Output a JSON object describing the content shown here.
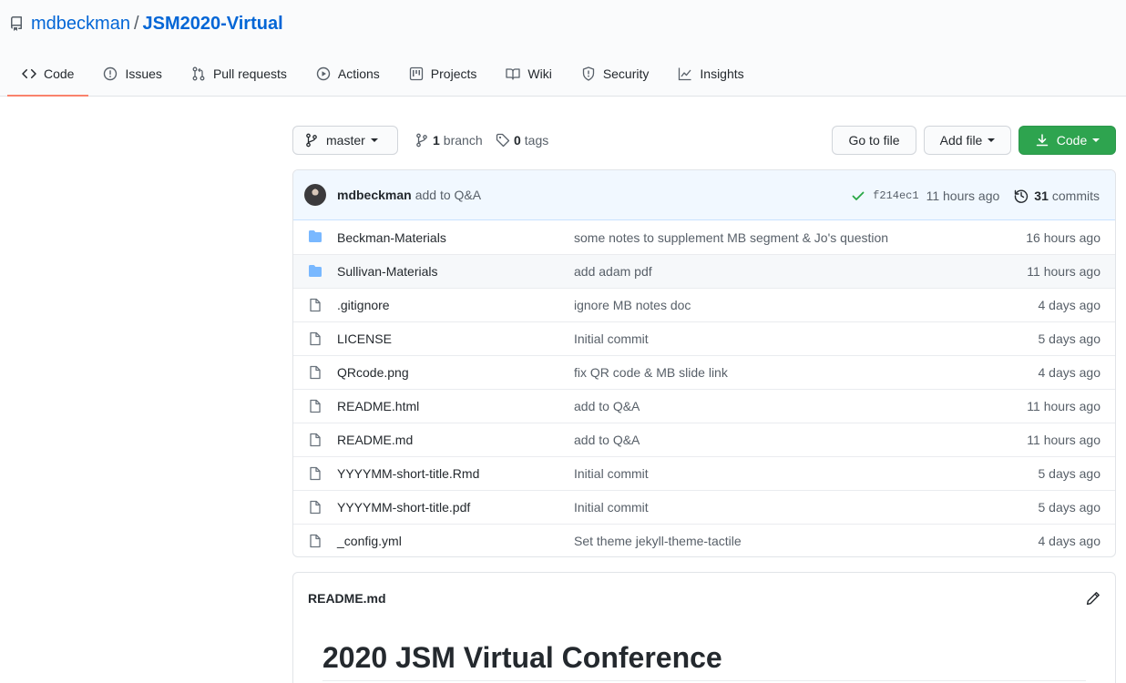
{
  "repo": {
    "owner": "mdbeckman",
    "separator": "/",
    "name": "JSM2020-Virtual"
  },
  "tabs": [
    {
      "label": "Code",
      "icon": "code-icon",
      "active": true
    },
    {
      "label": "Issues",
      "icon": "issue-icon"
    },
    {
      "label": "Pull requests",
      "icon": "pull-request-icon"
    },
    {
      "label": "Actions",
      "icon": "play-icon"
    },
    {
      "label": "Projects",
      "icon": "project-icon"
    },
    {
      "label": "Wiki",
      "icon": "book-icon"
    },
    {
      "label": "Security",
      "icon": "shield-icon"
    },
    {
      "label": "Insights",
      "icon": "graph-icon"
    }
  ],
  "toolbar": {
    "branch_name": "master",
    "branch_count": "1",
    "branch_word": "branch",
    "tag_count": "0",
    "tag_word": "tags",
    "goto_label": "Go to file",
    "add_label": "Add file",
    "code_label": "Code"
  },
  "latest_commit": {
    "author": "mdbeckman",
    "message": "add to Q&A",
    "sha": "f214ec1",
    "age": "11 hours ago",
    "commit_count": "31",
    "commit_word": "commits"
  },
  "files": [
    {
      "name": "Beckman-Materials",
      "type": "folder",
      "message": "some notes to supplement MB segment & Jo's question",
      "age": "16 hours ago"
    },
    {
      "name": "Sullivan-Materials",
      "type": "folder",
      "message": "add adam pdf",
      "age": "11 hours ago"
    },
    {
      "name": ".gitignore",
      "type": "file",
      "message": "ignore MB notes doc",
      "age": "4 days ago"
    },
    {
      "name": "LICENSE",
      "type": "file",
      "message": "Initial commit",
      "age": "5 days ago"
    },
    {
      "name": "QRcode.png",
      "type": "file",
      "message": "fix QR code & MB slide link",
      "age": "4 days ago"
    },
    {
      "name": "README.html",
      "type": "file",
      "message": "add to Q&A",
      "age": "11 hours ago"
    },
    {
      "name": "README.md",
      "type": "file",
      "message": "add to Q&A",
      "age": "11 hours ago"
    },
    {
      "name": "YYYYMM-short-title.Rmd",
      "type": "file",
      "message": "Initial commit",
      "age": "5 days ago"
    },
    {
      "name": "YYYYMM-short-title.pdf",
      "type": "file",
      "message": "Initial commit",
      "age": "5 days ago"
    },
    {
      "name": "_config.yml",
      "type": "file",
      "message": "Set theme jekyll-theme-tactile",
      "age": "4 days ago"
    }
  ],
  "readme": {
    "filename": "README.md",
    "heading": "2020 JSM Virtual Conference"
  },
  "colors": {
    "link": "#0366d6",
    "active_tab_border": "#f9826c",
    "code_button": "#2ea44f",
    "folder": "#79b8ff",
    "check": "#28a745"
  }
}
